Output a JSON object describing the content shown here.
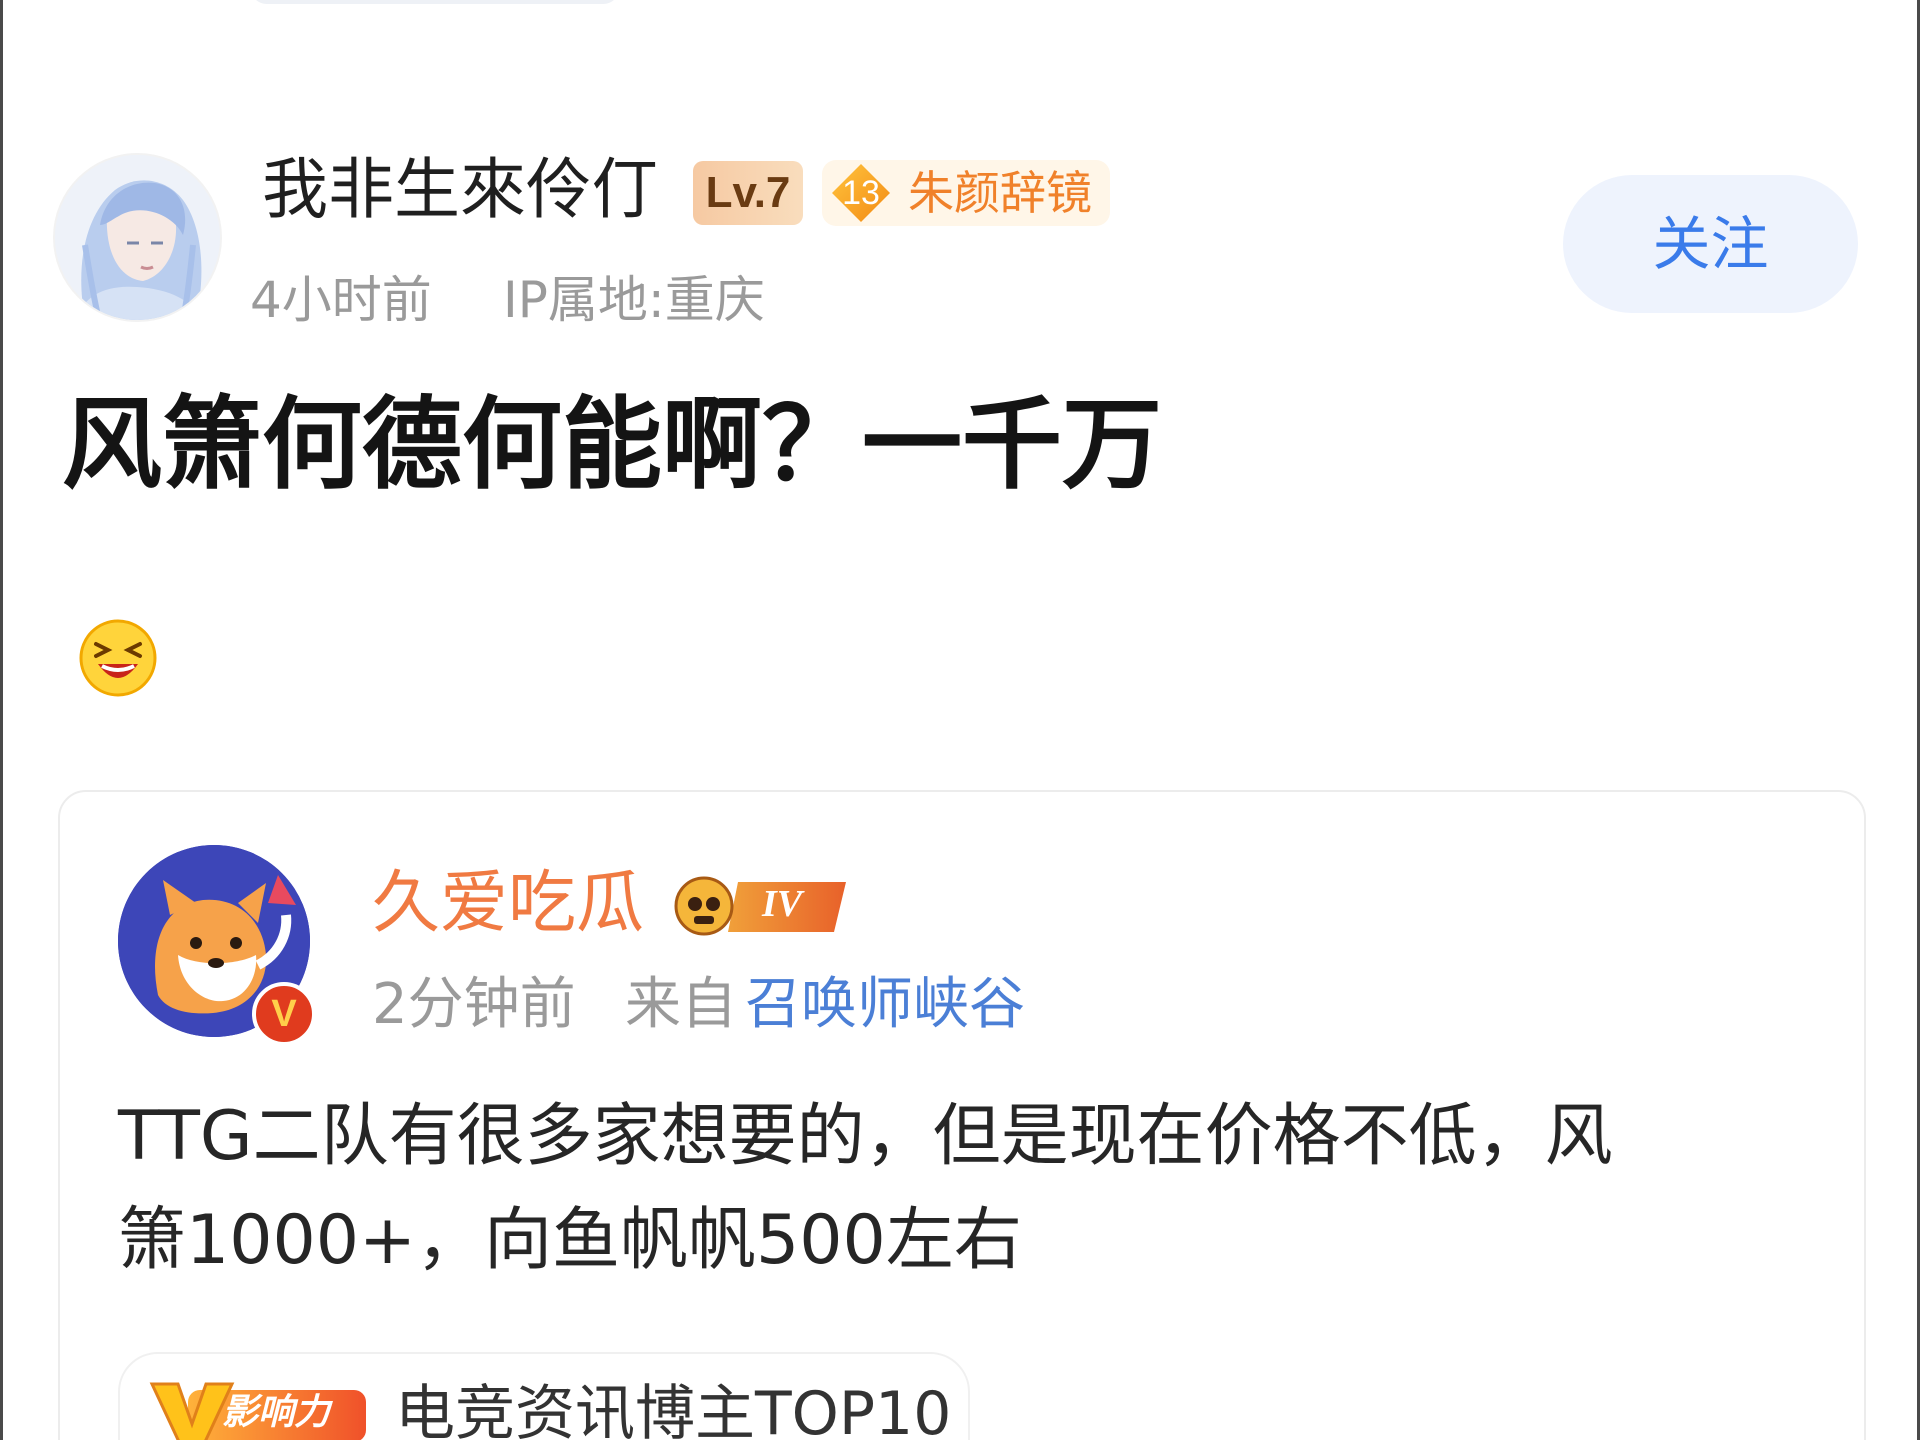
{
  "post": {
    "author": {
      "name": "我非生來伶仃",
      "level": "Lv.7",
      "fan_badge_level": "13",
      "fan_badge_name": "朱颜辞镜"
    },
    "time": "4小时前",
    "ip_location": "IP属地:重庆",
    "follow_label": "关注",
    "title": "风箫何德何能啊？一千万",
    "emoji": "laughing-face"
  },
  "quote": {
    "author": {
      "name": "久爱吃瓜",
      "rank_badge": "IV",
      "verified_mark": "V"
    },
    "time": "2分钟前",
    "from_prefix": "来自",
    "source": "召唤师峡谷",
    "body_lines": [
      "TTG二队有很多家想要的，但是现在价格不低，风",
      "箫1000+，向鱼帆帆500左右"
    ],
    "influence_badge": "影响力",
    "influence_text": "电竞资讯博主TOP10"
  },
  "colors": {
    "follow_text": "#3a7bea",
    "follow_bg": "#eef3fd",
    "quote_name": "#f07a42",
    "source_link": "#4b7fd6",
    "fan_badge_name": "#f0812a"
  }
}
